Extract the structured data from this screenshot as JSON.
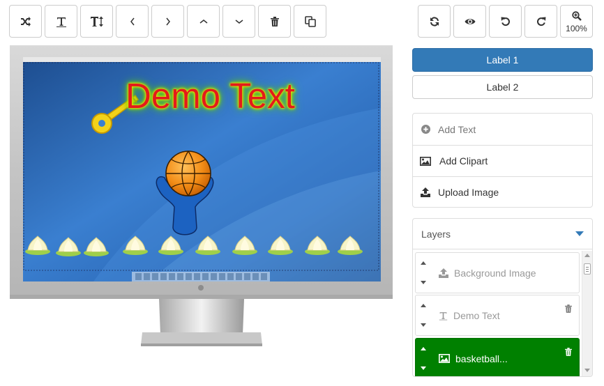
{
  "toolbar": {
    "left": [
      {
        "name": "shuffle-icon",
        "title": "random"
      },
      {
        "name": "text-icon",
        "title": "text"
      },
      {
        "name": "text-height-icon",
        "title": "text height"
      },
      {
        "name": "chevron-left-icon",
        "title": "move left"
      },
      {
        "name": "chevron-right-icon",
        "title": "move right"
      },
      {
        "name": "chevron-up-icon",
        "title": "move up"
      },
      {
        "name": "chevron-down-icon",
        "title": "move down"
      },
      {
        "name": "trash-icon",
        "title": "delete"
      },
      {
        "name": "copy-icon",
        "title": "duplicate"
      }
    ],
    "right": [
      {
        "name": "refresh-icon"
      },
      {
        "name": "eye-icon"
      },
      {
        "name": "undo-icon"
      },
      {
        "name": "redo-icon"
      },
      {
        "name": "zoom-in-icon"
      }
    ],
    "zoom_label": "100%"
  },
  "canvas": {
    "demo_text": "Demo Text",
    "screen_color": "#2b6cb8",
    "text_color": "#e31b1b",
    "glow_color": "#5fd000"
  },
  "labels": {
    "label1": "Label 1",
    "label2": "Label 2",
    "active_color": "#337ab7"
  },
  "actions": {
    "add_text": "Add Text",
    "add_clipart": "Add Clipart",
    "upload_image": "Upload Image"
  },
  "layers": {
    "title": "Layers",
    "items": [
      {
        "label": "Background Image",
        "icon": "upload-icon",
        "selected": false,
        "deletable": false
      },
      {
        "label": "Demo Text",
        "icon": "text-icon",
        "selected": false,
        "deletable": true
      },
      {
        "label": "basketball...",
        "icon": "image-icon",
        "selected": true,
        "deletable": true
      }
    ],
    "selected_color": "#008000"
  }
}
